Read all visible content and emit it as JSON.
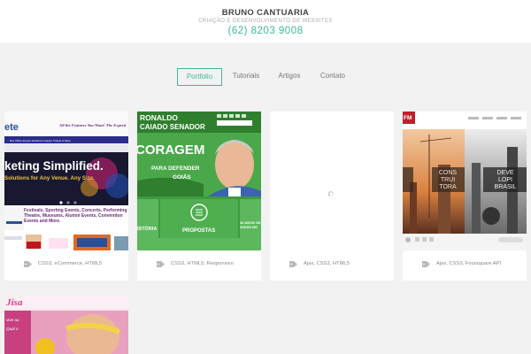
{
  "header": {
    "brand": "BRUNO CANTUARIA",
    "tagline": "CRIAÇÃO E DESENVOLVIMENTO DE WEBSITES",
    "phone": "(62) 8203 9008"
  },
  "nav": [
    {
      "label": "Portfolio",
      "active": true
    },
    {
      "label": "Tutoriais",
      "active": false
    },
    {
      "label": "Artigos",
      "active": false
    },
    {
      "label": "Contato",
      "active": false
    }
  ],
  "cards": [
    {
      "tags": "CSS3, eCommerce, HTML5",
      "thumb": {
        "header_line": "All the Features You Want! The Experti",
        "logo": "ete",
        "hero": "keting Simplified.",
        "hero_sub": "Solutions for Any Venue. Any Size.",
        "blurb": "Festivals, Sporting Events, Concerts, Performing Theatre, Museums, Alumni Events, Convention Events and More."
      }
    },
    {
      "tags": "CSS3, HTML5, Responsivo",
      "thumb": {
        "name_line1": "RONALDO",
        "name_line2": "CAIADO SENADOR",
        "headline": "CORAGEM",
        "sub1": "PARA DEFENDER",
        "sub2": "GOIÁS",
        "tile_a": "ISTÓRIA",
        "tile_b": "PROPOSTAS",
        "tile_c": "20 ANOS DE GOIÁS NO"
      }
    },
    {
      "tags": "Ajax, CSS3, HTML5",
      "thumb": {
        "loading": true
      }
    },
    {
      "tags": "Ajax, CSS3, Foursquare API",
      "thumb": {
        "badge": "FM",
        "left_line1": "CONS",
        "left_line2": "TRUI",
        "left_line3": "TORA",
        "right_line1": "DEVE",
        "right_line2": "LOPI",
        "right_line3": "BRASIL"
      }
    },
    {
      "tags": "",
      "thumb": {
        "logo": "Jisa"
      }
    }
  ],
  "colors": {
    "accent": "#3cb89a",
    "page_bg": "#f2f2f2"
  }
}
